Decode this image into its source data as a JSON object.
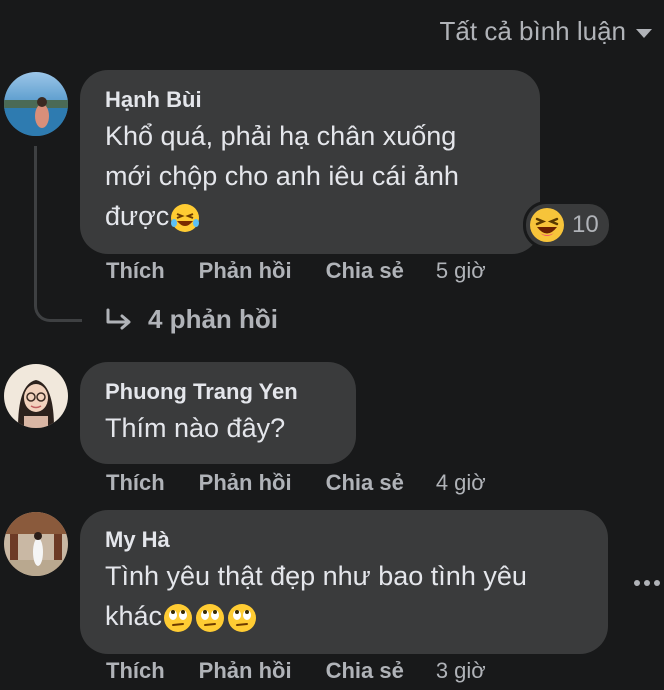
{
  "filter": {
    "label": "Tất cả bình luận"
  },
  "comments": [
    {
      "author": "Hạnh Bùi",
      "lines": [
        "Khổ quá, phải hạ chân xuống",
        "mới chộp cho anh iêu cái ảnh",
        "được"
      ],
      "reaction_count": "10",
      "actions": {
        "like": "Thích",
        "reply": "Phản hồi",
        "share": "Chia sẻ",
        "time": "5 giờ"
      },
      "replies_label": "4 phản hồi"
    },
    {
      "author": "Phuong Trang Yen",
      "lines": [
        "Thím nào đây?"
      ],
      "actions": {
        "like": "Thích",
        "reply": "Phản hồi",
        "share": "Chia sẻ",
        "time": "4 giờ"
      }
    },
    {
      "author": "My Hà",
      "lines": [
        "Tình yêu thật đẹp như bao tình yêu",
        "khác"
      ],
      "actions": {
        "like": "Thích",
        "reply": "Phản hồi",
        "share": "Chia sẻ",
        "time": "3 giờ"
      }
    }
  ],
  "colors": {
    "background": "#18191a",
    "bubble": "#3a3b3c",
    "text": "#e4e6eb",
    "muted": "#b0b3b8"
  },
  "icons": [
    "laughing-emoji-icon",
    "haha-reaction-icon",
    "reply-arrow-icon",
    "rolling-eyes-emoji-icon",
    "more-options-icon",
    "chevron-down-icon"
  ]
}
